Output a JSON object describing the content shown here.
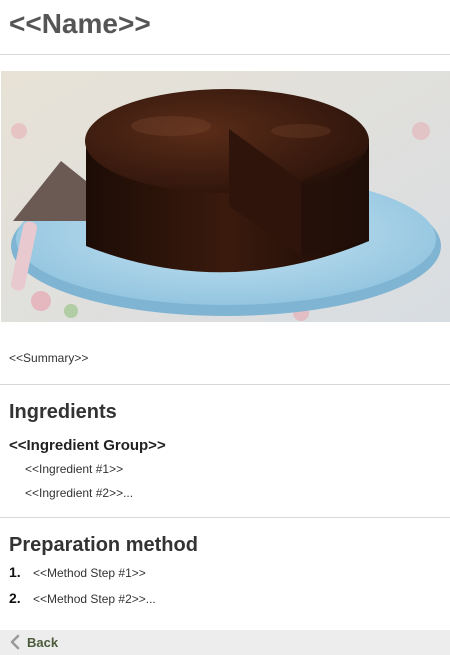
{
  "recipe": {
    "name": "<<Name>>",
    "summary": "<<Summary>>",
    "ingredients_heading": "Ingredients",
    "ingredient_group": "<<Ingredient Group>>",
    "ingredients": [
      "<<Ingredient #1>>",
      "<<Ingredient #2>>..."
    ],
    "method_heading": "Preparation method",
    "steps": [
      {
        "num": "1.",
        "text": "<<Method Step #1>>"
      },
      {
        "num": "2.",
        "text": "<<Method Step #2>>..."
      }
    ]
  },
  "nav": {
    "back_label": "Back"
  },
  "colors": {
    "title": "#555555",
    "back_bar": "#ededed",
    "back_text": "#4a5a3a",
    "divider": "#d8d8d8"
  }
}
